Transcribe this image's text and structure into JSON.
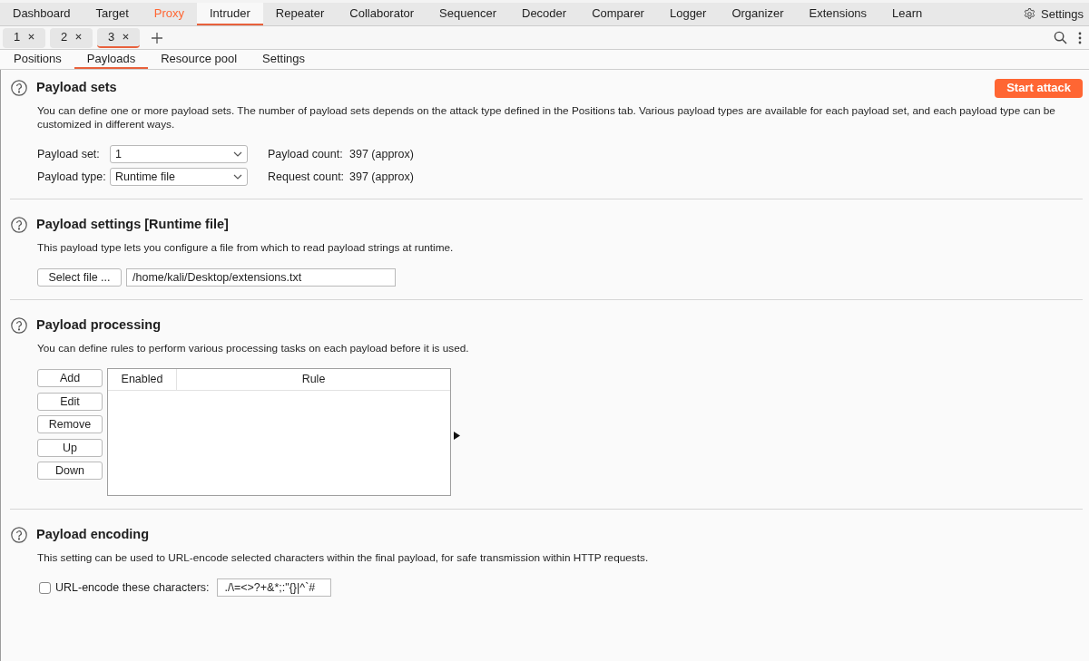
{
  "main_tabs": [
    {
      "label": "Dashboard",
      "selected": false,
      "alert": false
    },
    {
      "label": "Target",
      "selected": false,
      "alert": false
    },
    {
      "label": "Proxy",
      "selected": false,
      "alert": true
    },
    {
      "label": "Intruder",
      "selected": true,
      "alert": false
    },
    {
      "label": "Repeater",
      "selected": false,
      "alert": false
    },
    {
      "label": "Collaborator",
      "selected": false,
      "alert": false
    },
    {
      "label": "Sequencer",
      "selected": false,
      "alert": false
    },
    {
      "label": "Decoder",
      "selected": false,
      "alert": false
    },
    {
      "label": "Comparer",
      "selected": false,
      "alert": false
    },
    {
      "label": "Logger",
      "selected": false,
      "alert": false
    },
    {
      "label": "Organizer",
      "selected": false,
      "alert": false
    },
    {
      "label": "Extensions",
      "selected": false,
      "alert": false
    },
    {
      "label": "Learn",
      "selected": false,
      "alert": false
    }
  ],
  "settings_button": {
    "label": "Settings"
  },
  "request_tabs": [
    {
      "label": "1",
      "selected": false
    },
    {
      "label": "2",
      "selected": false
    },
    {
      "label": "3",
      "selected": true
    }
  ],
  "sub_tabs": [
    {
      "label": "Positions",
      "selected": false
    },
    {
      "label": "Payloads",
      "selected": true
    },
    {
      "label": "Resource pool",
      "selected": false
    },
    {
      "label": "Settings",
      "selected": false
    }
  ],
  "sections": [
    {
      "kind": "sets",
      "title": "Payload sets",
      "action_button": "Start attack",
      "description": "You can define one or more payload sets. The number of payload sets depends on the attack type defined in the Positions tab. Various payload types are available for each payload set, and each payload type can be customized in different ways.",
      "rows": [
        {
          "label": "Payload set:",
          "value": "1",
          "count_label": "Payload count:",
          "count_value": "397 (approx)"
        },
        {
          "label": "Payload type:",
          "value": "Runtime file",
          "count_label": "Request count:",
          "count_value": "397 (approx)"
        }
      ]
    },
    {
      "kind": "file",
      "title": "Payload settings [Runtime file]",
      "description": "This payload type lets you configure a file from which to read payload strings at runtime.",
      "button": "Select file ...",
      "file_path": "/home/kali/Desktop/extensions.txt"
    },
    {
      "kind": "processing",
      "title": "Payload processing",
      "description": "You can define rules to perform various processing tasks on each payload before it is used.",
      "buttons": [
        "Add",
        "Edit",
        "Remove",
        "Up",
        "Down"
      ],
      "table": {
        "columns": [
          "Enabled",
          "Rule"
        ]
      }
    },
    {
      "kind": "encoding",
      "title": "Payload encoding",
      "description": "This setting can be used to URL-encode selected characters within the final payload, for safe transmission within HTTP requests.",
      "checkbox": {
        "label": "URL-encode these characters:",
        "checked": false
      },
      "characters": "./\\=<>?+&*;:\"{}|^`#"
    }
  ]
}
